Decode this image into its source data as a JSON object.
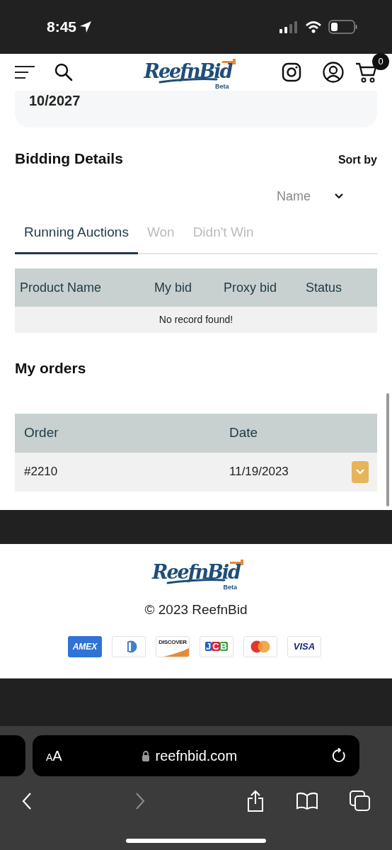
{
  "status_bar": {
    "time": "8:45"
  },
  "header": {
    "logo_text": "ReefnBid",
    "logo_badge": "Beta",
    "cart_count": "0"
  },
  "card": {
    "text": "10/2027"
  },
  "bidding": {
    "title": "Bidding Details",
    "sort_label": "Sort by",
    "sort_value": "Name",
    "tabs": [
      {
        "label": "Running Auctions",
        "selected": true
      },
      {
        "label": "Won",
        "selected": false
      },
      {
        "label": "Didn't Win",
        "selected": false
      }
    ],
    "columns": [
      "Product Name",
      "My bid",
      "Proxy bid",
      "Status"
    ],
    "empty_message": "No record found!"
  },
  "orders": {
    "title": "My orders",
    "columns": [
      "Order",
      "Date"
    ],
    "rows": [
      {
        "order": "#2210",
        "date": "11/19/2023"
      }
    ]
  },
  "footer": {
    "logo_text": "ReefnBid",
    "logo_badge": "Beta",
    "copyright": "© 2023 ReefnBid",
    "payment_cards": [
      {
        "kind": "amex",
        "label": "AMEX"
      },
      {
        "kind": "diners"
      },
      {
        "kind": "discover",
        "label": "DISCOVER"
      },
      {
        "kind": "jcb",
        "label": "JCB"
      },
      {
        "kind": "mastercard"
      },
      {
        "kind": "visa",
        "label": "VISA"
      }
    ]
  },
  "browser": {
    "text_size": "AA",
    "url": "reefnbid.com"
  }
}
